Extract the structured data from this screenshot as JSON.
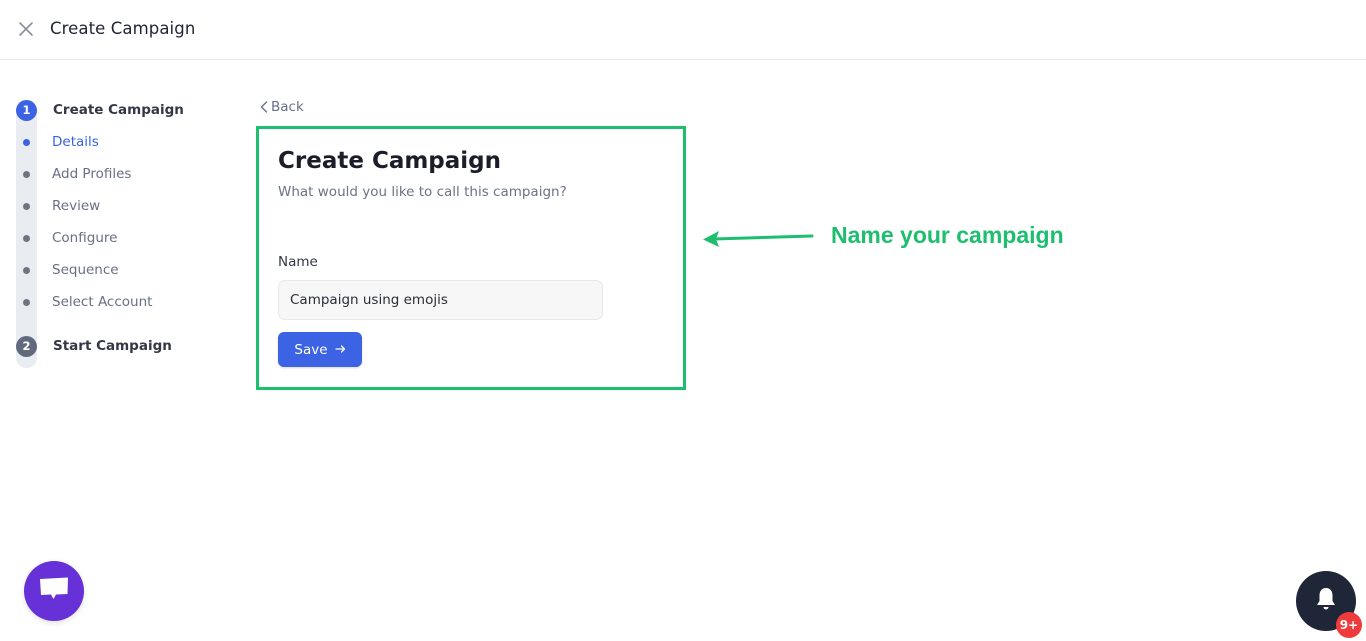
{
  "header": {
    "close_icon": "close-x-icon",
    "title": "Create Campaign"
  },
  "stepper": {
    "steps": [
      {
        "number": "1",
        "label": "Create Campaign",
        "state": "active",
        "sub_steps": [
          {
            "label": "Details",
            "state": "active"
          },
          {
            "label": "Add Profiles",
            "state": "inactive"
          },
          {
            "label": "Review",
            "state": "inactive"
          },
          {
            "label": "Configure",
            "state": "inactive"
          },
          {
            "label": "Sequence",
            "state": "inactive"
          },
          {
            "label": "Select Account",
            "state": "inactive"
          }
        ]
      },
      {
        "number": "2",
        "label": "Start Campaign",
        "state": "inactive"
      }
    ]
  },
  "back": {
    "icon": "chevron-left-icon",
    "label": "Back"
  },
  "form": {
    "title": "Create Campaign",
    "subtitle": "What would you like to call this campaign?",
    "name_label": "Name",
    "name_value": "Campaign using emojis",
    "save_label": "Save",
    "save_icon": "arrow-right-icon"
  },
  "annotation": {
    "text": "Name your campaign",
    "color": "#1dbf6f"
  },
  "floating": {
    "chat_icon": "chat-bubble-icon",
    "bell_icon": "bell-icon",
    "notification_count": "9+"
  },
  "colors": {
    "accent": "#3b63e3",
    "highlight": "#1dbf6f",
    "chat": "#6631d6",
    "bell_bg": "#1e2638",
    "badge": "#ef3b3b"
  }
}
